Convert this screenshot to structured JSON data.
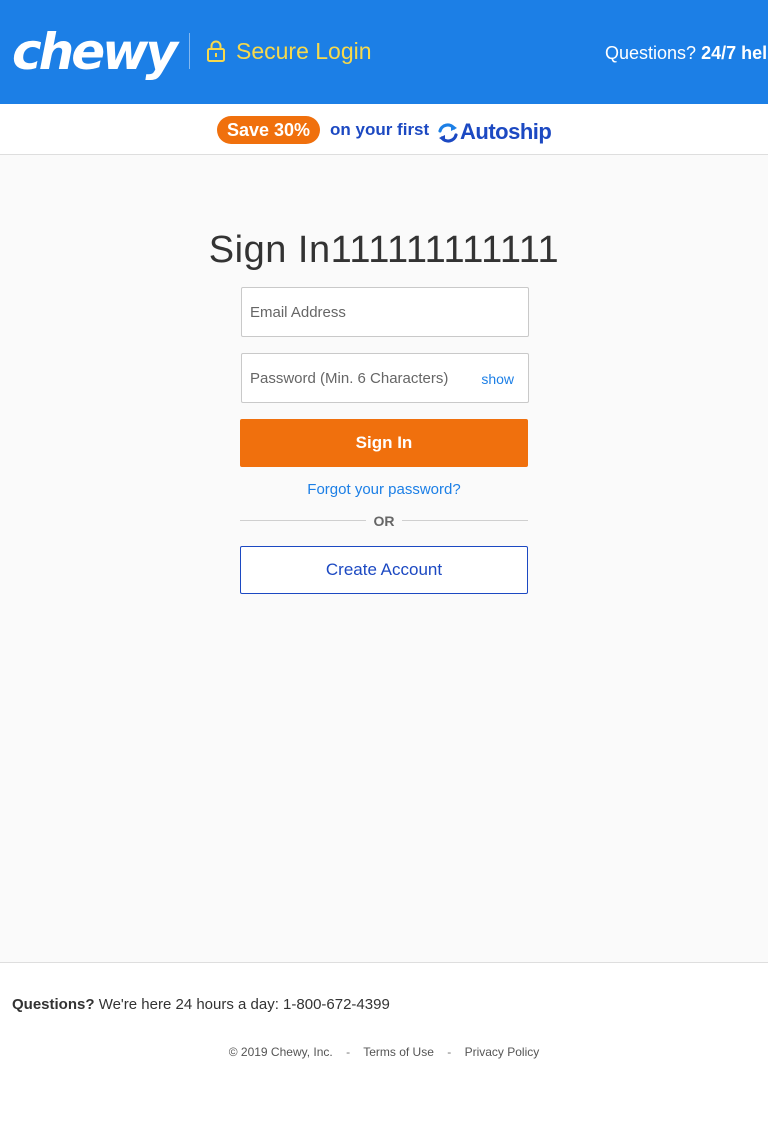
{
  "header": {
    "logo": "chewy",
    "secure_label": "Secure Login",
    "questions_label": "Questions?",
    "help_text": "24/7 hel"
  },
  "promo": {
    "save_label": "Save 30%",
    "text": "on your first",
    "autoship_label": "Autoship"
  },
  "signin": {
    "title": "Sign In111111111111",
    "email_placeholder": "Email Address",
    "password_placeholder": "Password (Min. 6 Characters)",
    "show_label": "show",
    "signin_button": "Sign In",
    "forgot_label": "Forgot your password?",
    "or_label": "OR",
    "create_account_button": "Create Account"
  },
  "footer": {
    "questions_label": "Questions?",
    "questions_text": "We're here 24 hours a day: 1-800-672-4399",
    "copyright": "© 2019 Chewy, Inc.",
    "terms_label": "Terms of Use",
    "privacy_label": "Privacy Policy",
    "separator": "-"
  },
  "colors": {
    "header_blue": "#1c7fe6",
    "accent_orange": "#f0700d",
    "secure_yellow": "#f7d94c",
    "brand_navy": "#1c49c2"
  },
  "icons": [
    "lock-icon",
    "autoship-arrows-icon"
  ]
}
